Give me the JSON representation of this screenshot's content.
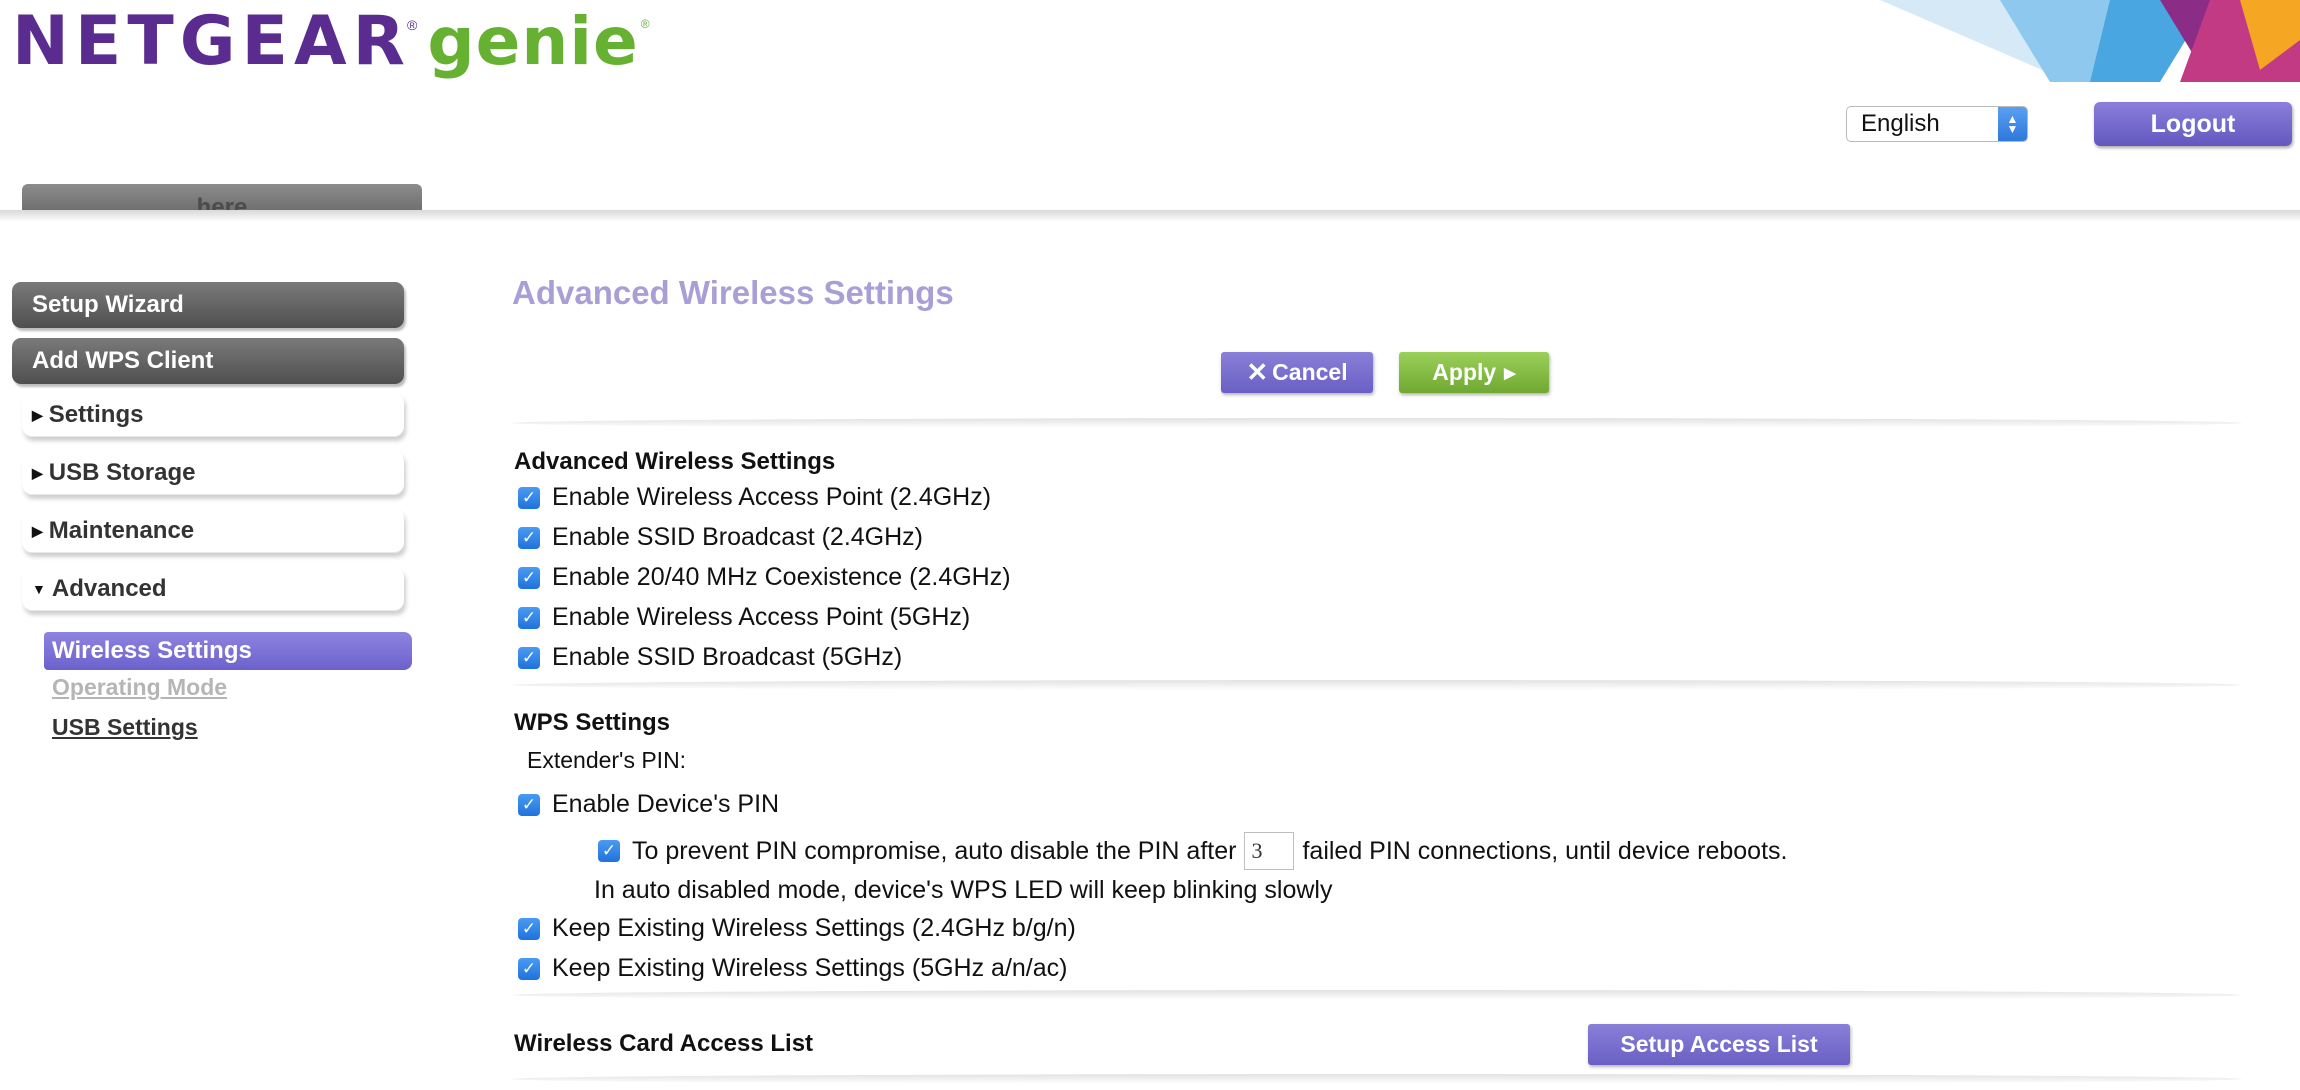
{
  "header": {
    "logo_brand": "NETGEAR",
    "logo_product": "genie",
    "logo_reg": "®",
    "language_selected": "English",
    "logout_label": "Logout",
    "tab_partial_label": "here"
  },
  "sidebar": {
    "primary": [
      {
        "label": "Setup Wizard"
      },
      {
        "label": "Add WPS Client"
      }
    ],
    "sections": [
      {
        "label": "Settings",
        "expanded": false
      },
      {
        "label": "USB Storage",
        "expanded": false
      },
      {
        "label": "Maintenance",
        "expanded": false
      },
      {
        "label": "Advanced",
        "expanded": true
      }
    ],
    "sub_items": [
      {
        "label": "Wireless Settings",
        "active": true
      },
      {
        "label": "Operating Mode",
        "active": false,
        "disabled": true
      },
      {
        "label": "USB Settings",
        "active": false
      }
    ]
  },
  "main": {
    "title": "Advanced Wireless Settings",
    "cancel_label": "Cancel",
    "apply_label": "Apply",
    "wireless_section": {
      "title": "Advanced Wireless Settings",
      "options": [
        {
          "label": "Enable Wireless Access Point (2.4GHz)",
          "checked": true
        },
        {
          "label": "Enable SSID Broadcast (2.4GHz)",
          "checked": true
        },
        {
          "label": "Enable 20/40 MHz Coexistence (2.4GHz)",
          "checked": true
        },
        {
          "label": "Enable Wireless Access Point (5GHz)",
          "checked": true
        },
        {
          "label": "Enable SSID Broadcast (5GHz)",
          "checked": true
        }
      ]
    },
    "wps_section": {
      "title": "WPS Settings",
      "extender_pin_label": "Extender's PIN:",
      "enable_device_pin": {
        "label": "Enable Device's PIN",
        "checked": true
      },
      "auto_disable": {
        "checked": true,
        "label_before": "To prevent PIN compromise, auto disable the PIN after",
        "value": "3",
        "label_after": "failed PIN connections, until device reboots."
      },
      "auto_disabled_note": "In auto disabled mode, device's WPS LED will keep blinking slowly",
      "keep_24": {
        "label": "Keep Existing Wireless Settings (2.4GHz b/g/n)",
        "checked": true
      },
      "keep_5": {
        "label": "Keep Existing Wireless Settings (5GHz a/n/ac)",
        "checked": true
      }
    },
    "access_list": {
      "title": "Wireless Card Access List",
      "button_label": "Setup Access List"
    }
  },
  "colors": {
    "brand_purple": "#5b2c8f",
    "brand_green": "#66b132",
    "button_purple": "#6a5fc4",
    "button_green": "#6fa832",
    "title_lavender": "#a99fd6",
    "checkbox_blue": "#1f72dd"
  }
}
